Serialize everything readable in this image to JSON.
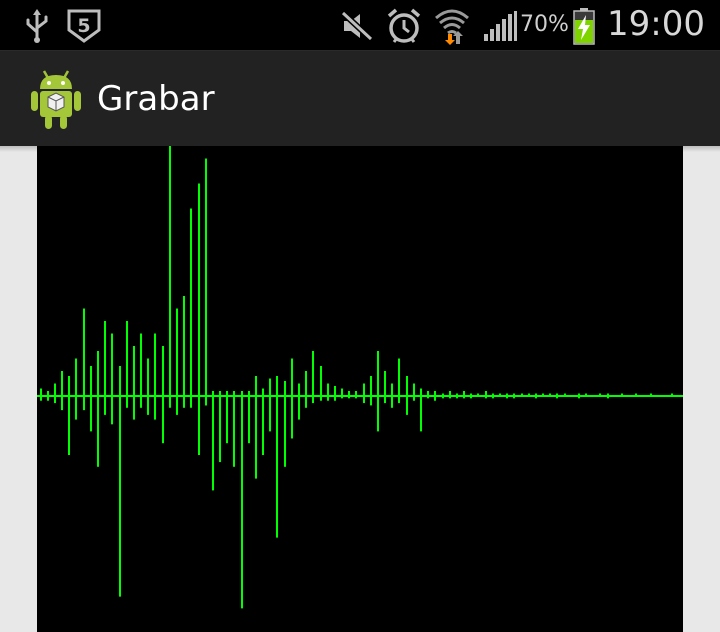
{
  "status_bar": {
    "icons": [
      "usb-icon",
      "s-badge-icon",
      "muted-icon",
      "alarm-icon",
      "wifi-icon",
      "signal-icon",
      "battery-charging-icon"
    ],
    "battery_percent": "70%",
    "time": "19:00",
    "accent_color": "#ff8a00",
    "battery_color": "#7fd400"
  },
  "action_bar": {
    "title": "Grabar",
    "icon": "android-app-icon"
  },
  "waveform": {
    "background": "#000000",
    "line_color": "#00ff00",
    "amplitudes": [
      [
        0.03,
        -0.02
      ],
      [
        0.02,
        -0.02
      ],
      [
        0.05,
        -0.03
      ],
      [
        0.1,
        -0.06
      ],
      [
        0.08,
        -0.25
      ],
      [
        0.15,
        -0.1
      ],
      [
        0.35,
        -0.06
      ],
      [
        0.12,
        -0.15
      ],
      [
        0.18,
        -0.3
      ],
      [
        0.3,
        -0.08
      ],
      [
        0.25,
        -0.12
      ],
      [
        0.12,
        -0.85
      ],
      [
        0.3,
        -0.05
      ],
      [
        0.2,
        -0.1
      ],
      [
        0.25,
        -0.05
      ],
      [
        0.15,
        -0.08
      ],
      [
        0.25,
        -0.1
      ],
      [
        0.2,
        -0.2
      ],
      [
        1.0,
        -0.05
      ],
      [
        0.35,
        -0.08
      ],
      [
        0.4,
        -0.05
      ],
      [
        0.75,
        -0.05
      ],
      [
        0.85,
        -0.25
      ],
      [
        0.95,
        -0.04
      ],
      [
        0.02,
        -0.4
      ],
      [
        0.02,
        -0.28
      ],
      [
        0.02,
        -0.2
      ],
      [
        0.02,
        -0.3
      ],
      [
        0.02,
        -0.9
      ],
      [
        0.02,
        -0.2
      ],
      [
        0.08,
        -0.35
      ],
      [
        0.03,
        -0.25
      ],
      [
        0.07,
        -0.15
      ],
      [
        0.08,
        -0.6
      ],
      [
        0.06,
        -0.3
      ],
      [
        0.15,
        -0.18
      ],
      [
        0.05,
        -0.1
      ],
      [
        0.1,
        -0.05
      ],
      [
        0.18,
        -0.03
      ],
      [
        0.12,
        -0.02
      ],
      [
        0.05,
        -0.02
      ],
      [
        0.04,
        -0.02
      ],
      [
        0.03,
        -0.01
      ],
      [
        0.02,
        -0.01
      ],
      [
        0.02,
        -0.01
      ],
      [
        0.05,
        -0.03
      ],
      [
        0.08,
        -0.04
      ],
      [
        0.18,
        -0.15
      ],
      [
        0.1,
        -0.03
      ],
      [
        0.05,
        -0.05
      ],
      [
        0.15,
        -0.03
      ],
      [
        0.08,
        -0.08
      ],
      [
        0.05,
        -0.02
      ],
      [
        0.03,
        -0.15
      ],
      [
        0.02,
        -0.01
      ],
      [
        0.02,
        -0.02
      ],
      [
        0.01,
        -0.01
      ],
      [
        0.02,
        -0.01
      ],
      [
        0.01,
        -0.01
      ],
      [
        0.02,
        -0.01
      ],
      [
        0.01,
        -0.01
      ],
      [
        0.01,
        0.0
      ],
      [
        0.02,
        -0.01
      ],
      [
        0.01,
        -0.01
      ],
      [
        0.01,
        0.0
      ],
      [
        0.01,
        -0.01
      ],
      [
        0.01,
        -0.01
      ],
      [
        0.01,
        0.0
      ],
      [
        0.01,
        0.0
      ],
      [
        0.01,
        -0.01
      ],
      [
        0.01,
        0.0
      ],
      [
        0.01,
        0.0
      ],
      [
        0.01,
        -0.01
      ],
      [
        0.01,
        0.0
      ],
      [
        0.0,
        0.0
      ],
      [
        0.01,
        -0.01
      ],
      [
        0.01,
        0.0
      ],
      [
        0.0,
        0.0
      ],
      [
        0.01,
        0.0
      ],
      [
        0.01,
        -0.01
      ],
      [
        0.0,
        0.0
      ],
      [
        0.01,
        0.0
      ],
      [
        0.0,
        0.0
      ],
      [
        0.01,
        0.0
      ],
      [
        0.0,
        0.0
      ],
      [
        0.01,
        0.0
      ],
      [
        0.0,
        0.0
      ],
      [
        0.0,
        0.0
      ],
      [
        0.01,
        0.0
      ],
      [
        0.0,
        0.0
      ]
    ]
  }
}
